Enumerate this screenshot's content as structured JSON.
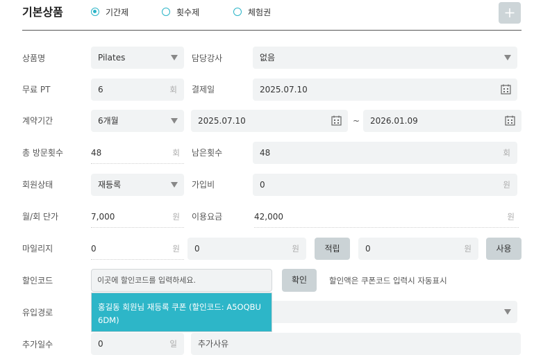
{
  "header": {
    "title": "기본상품",
    "radios": [
      {
        "label": "기간제",
        "selected": true
      },
      {
        "label": "횟수제",
        "selected": false
      },
      {
        "label": "체험권",
        "selected": false
      }
    ],
    "add_icon": "plus-icon"
  },
  "labels": {
    "product_name": "상품명",
    "free_pt": "무료 PT",
    "contract_period": "계약기간",
    "total_visits": "총 방문횟수",
    "member_status": "회원상태",
    "unit_price": "월/회 단가",
    "mileage": "마일리지",
    "discount_code": "할인코드",
    "inflow": "유입경로",
    "extra_days": "추가일수",
    "instructor": "담당강사",
    "payment_date": "결제일",
    "remaining_visits": "남은횟수",
    "join_fee": "가입비",
    "usage_fee": "이용요금"
  },
  "fields": {
    "product_name": "Pilates",
    "instructor": "없음",
    "free_pt": "6",
    "free_pt_unit": "회",
    "payment_date": "2025.07.10",
    "contract_period": "6개월",
    "start_date": "2025.07.10",
    "tilde": "~",
    "end_date": "2026.01.09",
    "total_visits": "48",
    "total_visits_unit": "회",
    "remaining_visits": "48",
    "remaining_visits_unit": "회",
    "member_status": "재등록",
    "join_fee": "0",
    "join_fee_unit": "원",
    "unit_price": "7,000",
    "unit_price_unit": "원",
    "usage_fee": "42,000",
    "usage_fee_unit": "원",
    "mileage": "0",
    "mileage_unit": "원",
    "mileage_accrue": "0",
    "mileage_accrue_unit": "원",
    "mileage_use": "0",
    "mileage_use_unit": "원",
    "discount_placeholder": "이곳에 할인코드를 입력하세요.",
    "discount_hint": "할인액은 쿠폰코드 입력시 자동표시",
    "extra_days": "0",
    "extra_days_unit": "일",
    "extra_reason_placeholder": "추가사유"
  },
  "buttons": {
    "accrue": "적립",
    "use": "사용",
    "confirm": "확인"
  },
  "dropdown": {
    "suggestion": "홍길동 회원님 재등록 쿠폰 (할인코드: A5OQBU6DM)"
  },
  "colors": {
    "accent": "#2bb4c7",
    "field_bg": "#f1f3f4",
    "button_bg": "#cbd3d6"
  }
}
